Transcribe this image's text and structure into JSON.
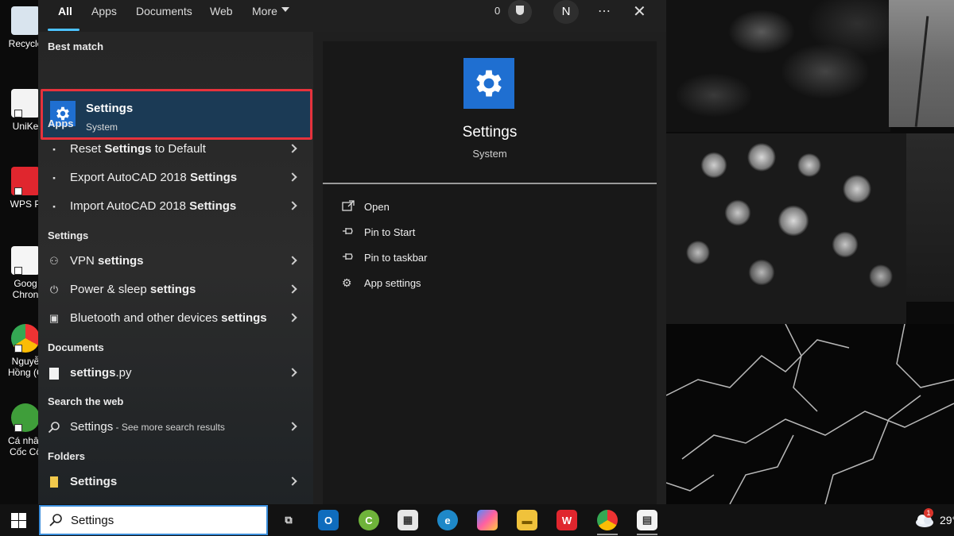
{
  "desktop": {
    "icons": [
      {
        "label": "Recycle",
        "name": "recycle-bin-icon"
      },
      {
        "label": "UniKe",
        "name": "unikey-icon"
      },
      {
        "label": "WPS P",
        "name": "wps-icon"
      },
      {
        "label": "Goog",
        "label2": "Chron",
        "name": "google-chrome-shortcut-icon"
      },
      {
        "label": "Nguyễ",
        "label2": "Hồng (G",
        "name": "chrome-profile-icon"
      },
      {
        "label": "Cá nhân",
        "label2": "Cốc Cố",
        "name": "coccoc-icon"
      }
    ]
  },
  "filter_bar": {
    "tabs": [
      "All",
      "Apps",
      "Documents",
      "Web",
      "More"
    ],
    "points": "0",
    "avatar_initial": "N",
    "more_label": "⋯",
    "close_label": "✕"
  },
  "results": {
    "best_match_header": "Best match",
    "best_match": {
      "title": "Settings",
      "subtitle": "System"
    },
    "apps_header": "Apps",
    "apps": [
      {
        "pre": "Reset ",
        "bold": "Settings",
        "post": " to Default"
      },
      {
        "pre": "Export AutoCAD 2018 ",
        "bold": "Settings",
        "post": ""
      },
      {
        "pre": "Import AutoCAD 2018 ",
        "bold": "Settings",
        "post": ""
      }
    ],
    "settings_header": "Settings",
    "settings": [
      {
        "pre": "VPN ",
        "bold": "settings",
        "post": ""
      },
      {
        "pre": "Power & sleep ",
        "bold": "settings",
        "post": ""
      },
      {
        "pre": "Bluetooth and other devices ",
        "bold": "settings",
        "post": ""
      }
    ],
    "documents_header": "Documents",
    "documents": [
      {
        "pre": "",
        "bold": "settings",
        "post": ".py"
      }
    ],
    "web_header": "Search the web",
    "web": {
      "main": "Settings",
      "muted": " - See more search results"
    },
    "folders_header": "Folders",
    "folders": [
      {
        "pre": "",
        "bold": "Settings",
        "post": ""
      }
    ]
  },
  "preview": {
    "title": "Settings",
    "subtitle": "System",
    "actions": [
      {
        "label": "Open",
        "icon": "open-icon"
      },
      {
        "label": "Pin to Start",
        "icon": "pin-icon"
      },
      {
        "label": "Pin to taskbar",
        "icon": "pin-icon"
      },
      {
        "label": "App settings",
        "icon": "gear-icon"
      }
    ]
  },
  "taskbar": {
    "search_value": "Settings",
    "weather_badge": "1",
    "weather_temp": "29°"
  },
  "colors": {
    "accent": "#4cc2ff",
    "settings_blue": "#1f6fd1",
    "highlight_border": "#e6323c",
    "selected_row": "#1b3a55"
  }
}
